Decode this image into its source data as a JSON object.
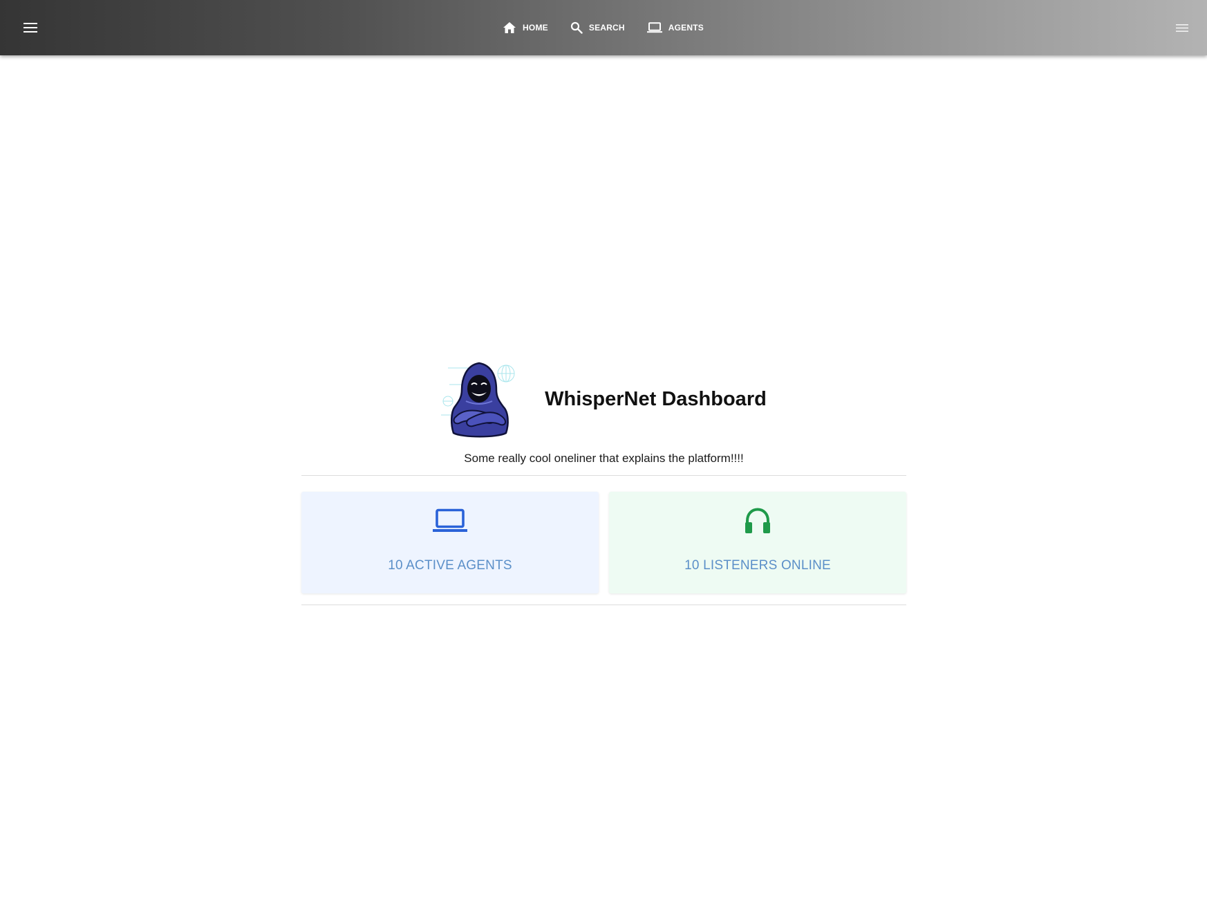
{
  "header": {
    "nav": [
      {
        "label": "HOME",
        "icon": "home-icon"
      },
      {
        "label": "SEARCH",
        "icon": "search-icon"
      },
      {
        "label": "AGENTS",
        "icon": "laptop-icon"
      }
    ],
    "left_menu_icon": "hamburger-menu-icon",
    "right_menu_icon": "menu-icon"
  },
  "main": {
    "title": "WhisperNet Dashboard",
    "tagline": "Some really cool oneliner that explains the platform!!!!",
    "logo_icon": "hooded-hacker-logo",
    "cards": [
      {
        "label": "10 ACTIVE AGENTS",
        "icon": "laptop-icon",
        "icon_color": "#2a62d8",
        "background": "#eef4ff"
      },
      {
        "label": "10 LISTENERS ONLINE",
        "icon": "headphones-icon",
        "icon_color": "#1f9a4a",
        "background": "#eefbf3"
      }
    ]
  },
  "colors": {
    "card_label": "#5b8fc8",
    "appbar_start": "#353535",
    "appbar_end": "#b3b3b3"
  }
}
